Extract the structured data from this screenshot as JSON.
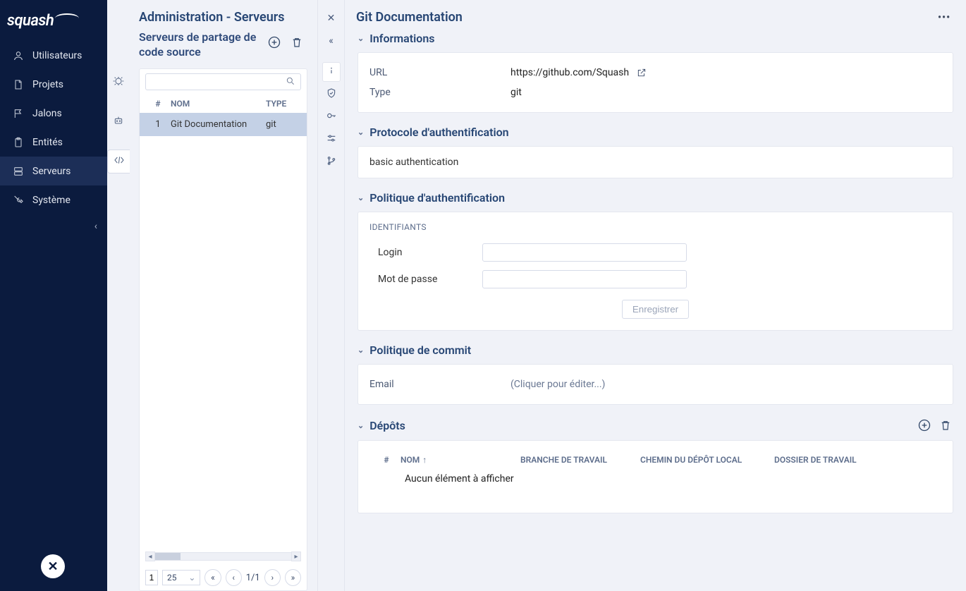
{
  "nav": {
    "items": [
      {
        "label": "Utilisateurs",
        "icon": "user"
      },
      {
        "label": "Projets",
        "icon": "file"
      },
      {
        "label": "Jalons",
        "icon": "flag"
      },
      {
        "label": "Entités",
        "icon": "clipboard"
      },
      {
        "label": "Serveurs",
        "icon": "server"
      },
      {
        "label": "Système",
        "icon": "wrench"
      }
    ]
  },
  "mid": {
    "title": "Administration - Serveurs",
    "subtitle": "Serveurs de partage de code source",
    "columns": {
      "idx": "#",
      "name": "NOM",
      "type": "TYPE"
    },
    "rows": [
      {
        "idx": "1",
        "name": "Git Documentation",
        "type": "git"
      }
    ],
    "pager": {
      "page": "1",
      "size": "25",
      "range": "1/1"
    }
  },
  "detail": {
    "title": "Git Documentation",
    "sections": {
      "info": {
        "title": "Informations",
        "url_label": "URL",
        "url_value": "https://github.com/Squash",
        "type_label": "Type",
        "type_value": "git"
      },
      "proto": {
        "title": "Protocole d'authentification",
        "value": "basic authentication"
      },
      "authpol": {
        "title": "Politique d'authentification",
        "creds_label": "IDENTIFIANTS",
        "login_label": "Login",
        "login_value": "",
        "pwd_label": "Mot de passe",
        "pwd_value": "",
        "save_label": "Enregistrer"
      },
      "commit": {
        "title": "Politique de commit",
        "email_label": "Email",
        "email_placeholder": "(Cliquer pour éditer...)"
      },
      "repos": {
        "title": "Dépôts",
        "columns": {
          "idx": "#",
          "name": "NOM",
          "branch": "BRANCHE DE TRAVAIL",
          "path": "CHEMIN DU DÉPÔT LOCAL",
          "folder": "DOSSIER DE TRAVAIL"
        },
        "empty": "Aucun élément à afficher"
      }
    }
  }
}
